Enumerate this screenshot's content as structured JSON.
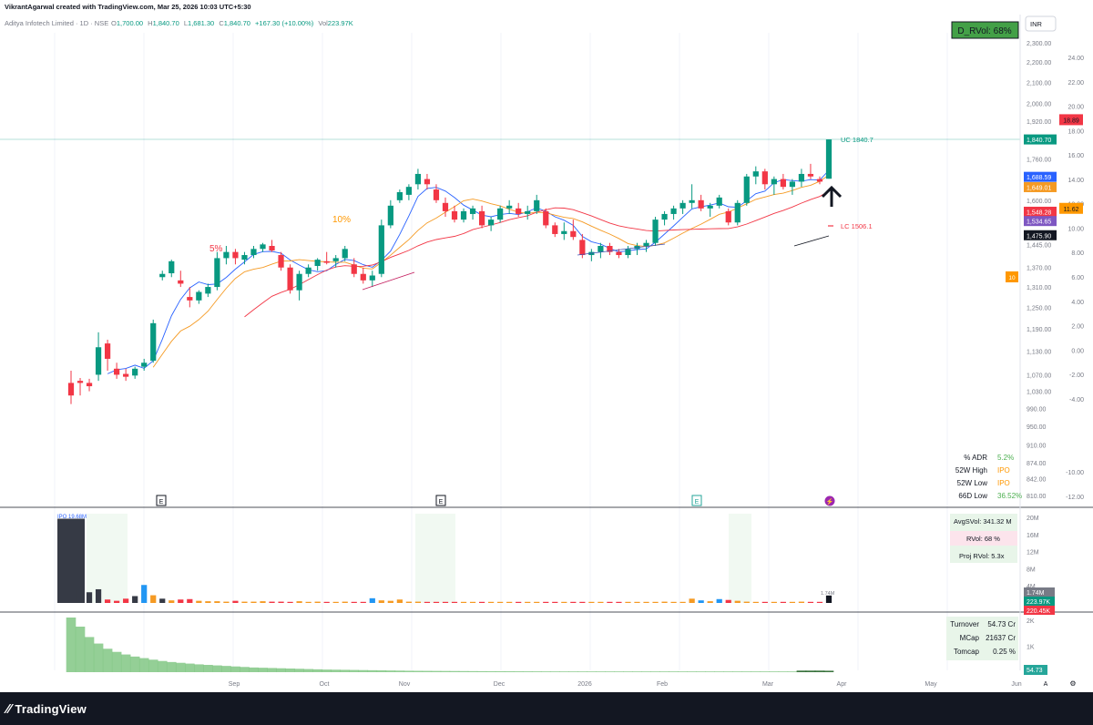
{
  "header": {
    "attribution": "VikrantAgarwal created with TradingView.com, Mar 25, 2026 10:03 UTC+5:30"
  },
  "legend": {
    "symbol": "Aditya Infotech Limited · 1D · NSE",
    "o_label": "O",
    "o": "1,700.00",
    "h_label": "H",
    "h": "1,840.70",
    "l_label": "L",
    "l": "1,681.30",
    "c_label": "C",
    "c": "1,840.70",
    "chg": "+167.30 (+10.00%)",
    "vol_label": "Vol",
    "vol": "223.97K"
  },
  "badges": {
    "d_rvol": "D_RVol: 68%",
    "currency": "INR"
  },
  "annotations": {
    "pct5": "5%",
    "pct10": "10%",
    "uc_label": "UC 1840.7",
    "lc_label": "LC 1506.1",
    "events": [
      "E",
      "E",
      "E",
      "⚡"
    ]
  },
  "stats_table": [
    {
      "label": "% ADR",
      "value": "5.2%",
      "color": "#4caf50"
    },
    {
      "label": "52W High",
      "value": "IPO",
      "color": "#ff9800"
    },
    {
      "label": "52W Low",
      "value": "IPO",
      "color": "#ff9800"
    },
    {
      "label": "66D Low",
      "value": "36.52%",
      "color": "#4caf50"
    }
  ],
  "volume_table": {
    "avg": "AvgSVol: 341.32 M",
    "rvol": "RVol: 68 %",
    "proj": "Proj RVol: 5.3x",
    "ipo_label": "IPO 19.68M",
    "last_label": "1.74M"
  },
  "turnover_table": [
    {
      "label": "Turnover",
      "value": "54.73 Cr"
    },
    {
      "label": "MCap",
      "value": "21637 Cr"
    },
    {
      "label": "Tomcap",
      "value": "0.25 %"
    }
  ],
  "price_axis": {
    "ticks": [
      "2,300.00",
      "2,200.00",
      "2,100.00",
      "2,000.00",
      "1,920.00",
      "1,840.00",
      "1,760.00",
      "1,680.00",
      "1,600.00",
      "1,525.00",
      "1,445.00",
      "1,370.00",
      "1,310.00",
      "1,250.00",
      "1,190.00",
      "1,130.00",
      "1,070.00",
      "1,030.00",
      "990.00",
      "950.00",
      "910.00",
      "874.00",
      "842.00",
      "810.00"
    ],
    "labels": [
      {
        "text": "1,840.70",
        "color": "#089981"
      },
      {
        "text": "1,688.59",
        "color": "#2962ff"
      },
      {
        "text": "1,649.01",
        "color": "#f59a23"
      },
      {
        "text": "1,548.28",
        "color": "#f23645"
      },
      {
        "text": "1,534.65",
        "color": "#7e57c2"
      },
      {
        "text": "1,475.90",
        "color": "#131722"
      }
    ]
  },
  "secondary_axis": {
    "ticks": [
      "24.00",
      "22.00",
      "20.00",
      "18.00",
      "16.00",
      "14.00",
      "12.00",
      "10.00",
      "8.00",
      "6.00",
      "4.00",
      "2.00",
      "0.00",
      "-2.00",
      "-4.00",
      "-10.00",
      "-12.00"
    ],
    "labels": [
      {
        "text": "18.89",
        "color": "#f23645"
      },
      {
        "text": "11.62",
        "color": "#ff9800"
      },
      {
        "text": "10",
        "color": "#ff9800"
      }
    ]
  },
  "volume_axis": {
    "ticks": [
      "20M",
      "16M",
      "12M",
      "8M",
      "4M"
    ],
    "labels": [
      {
        "text": "1.74M",
        "color": "#787b86"
      },
      {
        "text": "223.97K",
        "color": "#089981"
      },
      {
        "text": "220.45K",
        "color": "#f23645"
      }
    ]
  },
  "turnover_axis": {
    "ticks": [
      "2K",
      "1K"
    ],
    "label": {
      "text": "54.73",
      "color": "#26a69a"
    }
  },
  "time_axis": {
    "labels": [
      "Sep",
      "Oct",
      "Nov",
      "Dec",
      "2026",
      "Feb",
      "Mar",
      "Apr",
      "May",
      "Jun"
    ]
  },
  "footer": {
    "brand": "TradingView",
    "a_button": "A",
    "gear": "⚙"
  },
  "chart_data": {
    "type": "candlestick",
    "x_axis": [
      "Sep",
      "Oct",
      "Nov",
      "Dec",
      "2026",
      "Feb",
      "Mar",
      "Apr",
      "May",
      "Jun"
    ],
    "y_range": [
      810,
      2300
    ],
    "last": {
      "open": 1700.0,
      "high": 1840.7,
      "low": 1681.3,
      "close": 1840.7,
      "volume": "223.97K"
    },
    "candles": [
      [
        1050,
        1080,
        1000,
        1020
      ],
      [
        1055,
        1062,
        1020,
        1050
      ],
      [
        1050,
        1060,
        1030,
        1042
      ],
      [
        1070,
        1180,
        1055,
        1140
      ],
      [
        1150,
        1160,
        1080,
        1110
      ],
      [
        1085,
        1100,
        1060,
        1070
      ],
      [
        1072,
        1085,
        1055,
        1065
      ],
      [
        1068,
        1090,
        1060,
        1085
      ],
      [
        1090,
        1110,
        1080,
        1100
      ],
      [
        1105,
        1215,
        1100,
        1205
      ],
      [
        1340,
        1360,
        1330,
        1350
      ],
      [
        1352,
        1395,
        1340,
        1390
      ],
      [
        1330,
        1360,
        1310,
        1320
      ],
      [
        1280,
        1310,
        1250,
        1270
      ],
      [
        1270,
        1300,
        1260,
        1295
      ],
      [
        1290,
        1320,
        1280,
        1310
      ],
      [
        1310,
        1420,
        1300,
        1400
      ],
      [
        1400,
        1440,
        1380,
        1420
      ],
      [
        1420,
        1430,
        1380,
        1400
      ],
      [
        1395,
        1420,
        1380,
        1410
      ],
      [
        1410,
        1440,
        1400,
        1430
      ],
      [
        1430,
        1450,
        1420,
        1445
      ],
      [
        1440,
        1460,
        1420,
        1425
      ],
      [
        1410,
        1420,
        1360,
        1370
      ],
      [
        1370,
        1380,
        1290,
        1300
      ],
      [
        1300,
        1360,
        1270,
        1350
      ],
      [
        1350,
        1380,
        1340,
        1370
      ],
      [
        1375,
        1400,
        1360,
        1395
      ],
      [
        1390,
        1420,
        1380,
        1385
      ],
      [
        1390,
        1410,
        1370,
        1400
      ],
      [
        1400,
        1440,
        1390,
        1430
      ],
      [
        1380,
        1400,
        1340,
        1350
      ],
      [
        1350,
        1370,
        1320,
        1330
      ],
      [
        1330,
        1360,
        1310,
        1345
      ],
      [
        1350,
        1530,
        1340,
        1510
      ],
      [
        1510,
        1600,
        1500,
        1580
      ],
      [
        1600,
        1640,
        1590,
        1630
      ],
      [
        1620,
        1660,
        1600,
        1650
      ],
      [
        1660,
        1720,
        1640,
        1700
      ],
      [
        1680,
        1700,
        1640,
        1660
      ],
      [
        1640,
        1660,
        1590,
        1600
      ],
      [
        1590,
        1610,
        1540,
        1560
      ],
      [
        1560,
        1580,
        1520,
        1530
      ],
      [
        1530,
        1570,
        1520,
        1560
      ],
      [
        1550,
        1580,
        1530,
        1570
      ],
      [
        1560,
        1580,
        1500,
        1510
      ],
      [
        1510,
        1540,
        1490,
        1530
      ],
      [
        1530,
        1580,
        1520,
        1570
      ],
      [
        1570,
        1600,
        1550,
        1580
      ],
      [
        1570,
        1590,
        1540,
        1550
      ],
      [
        1550,
        1580,
        1530,
        1560
      ],
      [
        1560,
        1620,
        1550,
        1600
      ],
      [
        1560,
        1570,
        1500,
        1510
      ],
      [
        1510,
        1520,
        1470,
        1480
      ],
      [
        1480,
        1520,
        1460,
        1490
      ],
      [
        1490,
        1530,
        1460,
        1470
      ],
      [
        1460,
        1480,
        1400,
        1410
      ],
      [
        1410,
        1430,
        1390,
        1420
      ],
      [
        1420,
        1450,
        1400,
        1440
      ],
      [
        1440,
        1450,
        1410,
        1420
      ],
      [
        1420,
        1430,
        1400,
        1410
      ],
      [
        1410,
        1440,
        1400,
        1430
      ],
      [
        1430,
        1450,
        1410,
        1440
      ],
      [
        1440,
        1460,
        1420,
        1450
      ],
      [
        1450,
        1540,
        1440,
        1530
      ],
      [
        1530,
        1560,
        1510,
        1550
      ],
      [
        1550,
        1580,
        1530,
        1570
      ],
      [
        1570,
        1600,
        1550,
        1590
      ],
      [
        1590,
        1660,
        1570,
        1600
      ],
      [
        1600,
        1620,
        1560,
        1570
      ],
      [
        1570,
        1590,
        1540,
        1580
      ],
      [
        1580,
        1620,
        1570,
        1610
      ],
      [
        1560,
        1570,
        1510,
        1520
      ],
      [
        1520,
        1600,
        1510,
        1590
      ],
      [
        1590,
        1700,
        1580,
        1690
      ],
      [
        1690,
        1730,
        1660,
        1710
      ],
      [
        1710,
        1720,
        1640,
        1660
      ],
      [
        1660,
        1690,
        1620,
        1680
      ],
      [
        1680,
        1700,
        1640,
        1650
      ],
      [
        1650,
        1680,
        1620,
        1670
      ],
      [
        1670,
        1720,
        1650,
        1700
      ],
      [
        1700,
        1740,
        1680,
        1690
      ],
      [
        1680,
        1690,
        1660,
        1670
      ],
      [
        1681.3,
        1840.7,
        1681.3,
        1840.7
      ]
    ],
    "volume_M": [
      19.68,
      3.0,
      2.5,
      3.2,
      0.8,
      0.5,
      1.0,
      1.6,
      4.2,
      1.8,
      1.0,
      0.6,
      0.8,
      0.9,
      0.5,
      0.4,
      0.4,
      0.3,
      0.5,
      0.3,
      0.3,
      0.4,
      0.3,
      0.3,
      0.2,
      0.4,
      0.2,
      0.3,
      0.2,
      0.2,
      0.3,
      0.2,
      0.2,
      1.1,
      0.6,
      0.5,
      0.8,
      0.3,
      0.3,
      0.2,
      0.2,
      0.2,
      0.2,
      0.2,
      0.2,
      0.2,
      0.2,
      0.2,
      0.2,
      0.2,
      0.2,
      0.2,
      0.2,
      0.2,
      0.2,
      0.2,
      0.2,
      0.2,
      0.2,
      0.2,
      0.2,
      0.2,
      0.2,
      0.2,
      0.2,
      0.3,
      0.2,
      0.2,
      1.0,
      0.6,
      0.4,
      0.9,
      0.7,
      0.5,
      0.3,
      0.2,
      0.2,
      0.2,
      0.2,
      0.2,
      0.3,
      0.2,
      0.2,
      1.74
    ],
    "turnover_K": [
      2100,
      1750,
      1350,
      1100,
      900,
      780,
      680,
      600,
      540,
      480,
      430,
      390,
      360,
      330,
      300,
      280,
      260,
      240,
      220,
      200,
      180,
      170,
      160,
      150,
      140,
      130,
      120,
      110,
      100,
      95,
      90,
      85,
      80,
      75,
      70,
      65,
      60,
      55,
      52,
      50,
      48,
      46,
      44,
      42,
      40,
      38,
      36,
      35,
      34,
      33,
      32,
      31,
      30,
      29,
      28,
      27,
      26,
      25,
      24,
      23,
      22,
      21,
      20,
      20,
      20,
      20,
      20,
      20,
      20,
      20,
      20,
      20,
      20,
      20,
      20,
      20,
      20,
      20,
      20,
      20,
      60,
      60,
      60,
      55
    ]
  }
}
